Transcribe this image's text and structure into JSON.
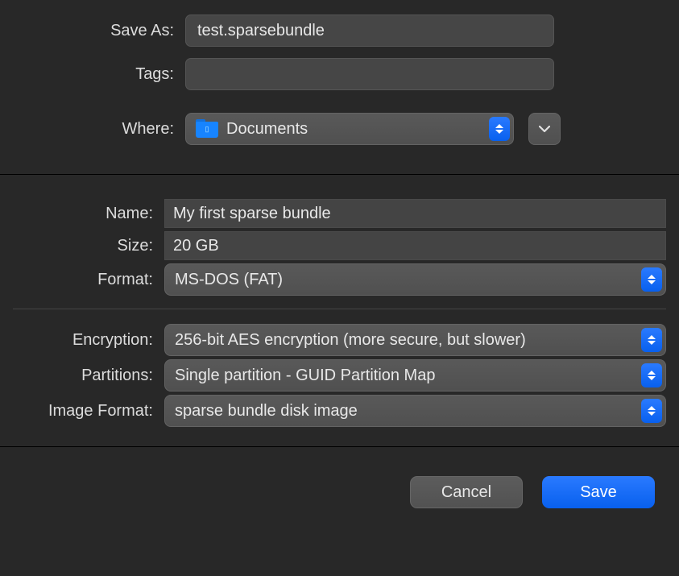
{
  "top": {
    "save_as_label": "Save As:",
    "save_as_value": "test.sparsebundle",
    "tags_label": "Tags:",
    "tags_value": "",
    "where_label": "Where:",
    "where_value": "Documents"
  },
  "mid": {
    "name_label": "Name:",
    "name_value": "My first sparse bundle",
    "size_label": "Size:",
    "size_value": "20 GB",
    "format_label": "Format:",
    "format_value": "MS-DOS (FAT)",
    "encryption_label": "Encryption:",
    "encryption_value": "256-bit AES encryption (more secure, but slower)",
    "partitions_label": "Partitions:",
    "partitions_value": "Single partition - GUID Partition Map",
    "image_format_label": "Image Format:",
    "image_format_value": "sparse bundle disk image"
  },
  "buttons": {
    "cancel_label": "Cancel",
    "save_label": "Save"
  }
}
